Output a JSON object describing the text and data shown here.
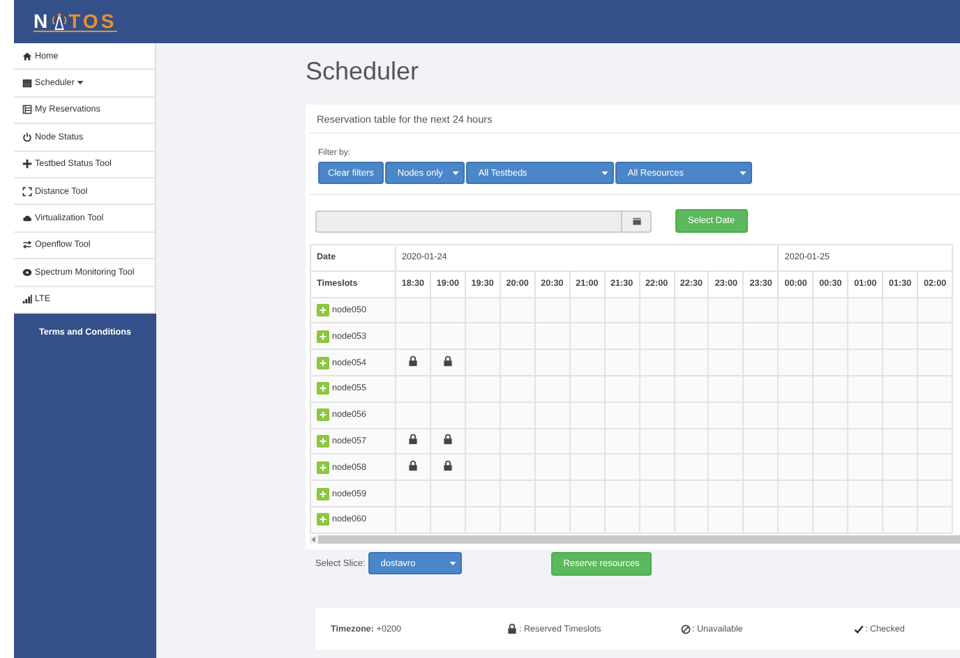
{
  "logo": {
    "left": "N",
    "right": "TOS"
  },
  "sidebar": {
    "items": [
      {
        "label": "Home",
        "dropdown": false
      },
      {
        "label": "Scheduler",
        "dropdown": true
      },
      {
        "label": "My Reservations",
        "dropdown": false
      },
      {
        "label": "Node Status",
        "dropdown": false
      },
      {
        "label": "Testbed Status Tool",
        "dropdown": false
      },
      {
        "label": "Distance Tool",
        "dropdown": false
      },
      {
        "label": "Virtualization Tool",
        "dropdown": false
      },
      {
        "label": "Openflow Tool",
        "dropdown": false
      },
      {
        "label": "Spectrum Monitoring Tool",
        "dropdown": false
      },
      {
        "label": "LTE",
        "dropdown": false
      }
    ],
    "footer": "Terms and Conditions"
  },
  "page_title": "Scheduler",
  "panel": {
    "heading": "Reservation table for the next 24 hours",
    "filter_label": "Filter by:",
    "clear_button": "Clear filters",
    "filters": [
      "Nodes only",
      "All Testbeds",
      "All Resources"
    ],
    "select_date_button": "Select Date",
    "table": {
      "date_heading": "Date",
      "timeslots_heading": "Timeslots",
      "dates": [
        {
          "date": "2020-01-24",
          "timeslots": [
            "18:30",
            "19:00",
            "19:30",
            "20:00",
            "20:30",
            "21:00",
            "21:30",
            "22:00",
            "22:30",
            "23:00",
            "23:30"
          ]
        },
        {
          "date": "2020-01-25",
          "timeslots": [
            "00:00",
            "00:30",
            "01:00",
            "01:30",
            "02:00"
          ]
        }
      ],
      "rows": [
        {
          "node": "node050",
          "reserved": [
            false,
            false,
            false,
            false,
            false,
            false,
            false,
            false,
            false,
            false,
            false,
            false,
            false,
            false,
            false,
            false
          ]
        },
        {
          "node": "node053",
          "reserved": [
            false,
            false,
            false,
            false,
            false,
            false,
            false,
            false,
            false,
            false,
            false,
            false,
            false,
            false,
            false,
            false
          ]
        },
        {
          "node": "node054",
          "reserved": [
            true,
            true,
            false,
            false,
            false,
            false,
            false,
            false,
            false,
            false,
            false,
            false,
            false,
            false,
            false,
            false
          ]
        },
        {
          "node": "node055",
          "reserved": [
            false,
            false,
            false,
            false,
            false,
            false,
            false,
            false,
            false,
            false,
            false,
            false,
            false,
            false,
            false,
            false
          ]
        },
        {
          "node": "node056",
          "reserved": [
            false,
            false,
            false,
            false,
            false,
            false,
            false,
            false,
            false,
            false,
            false,
            false,
            false,
            false,
            false,
            false
          ]
        },
        {
          "node": "node057",
          "reserved": [
            true,
            true,
            false,
            false,
            false,
            false,
            false,
            false,
            false,
            false,
            false,
            false,
            false,
            false,
            false,
            false
          ]
        },
        {
          "node": "node058",
          "reserved": [
            true,
            true,
            false,
            false,
            false,
            false,
            false,
            false,
            false,
            false,
            false,
            false,
            false,
            false,
            false,
            false
          ]
        },
        {
          "node": "node059",
          "reserved": [
            false,
            false,
            false,
            false,
            false,
            false,
            false,
            false,
            false,
            false,
            false,
            false,
            false,
            false,
            false,
            false
          ]
        },
        {
          "node": "node060",
          "reserved": [
            false,
            false,
            false,
            false,
            false,
            false,
            false,
            false,
            false,
            false,
            false,
            false,
            false,
            false,
            false,
            false
          ]
        }
      ]
    },
    "slice_label": "Select Slice:",
    "slice": "dostavro",
    "reserve_button": "Reserve resources"
  },
  "legend": {
    "timezone_label": "Timezone:",
    "timezone": "+0200",
    "items": [
      {
        "label": ": Reserved Timeslots"
      },
      {
        "label": ": Unavailable"
      },
      {
        "label": ": Checked"
      }
    ]
  }
}
